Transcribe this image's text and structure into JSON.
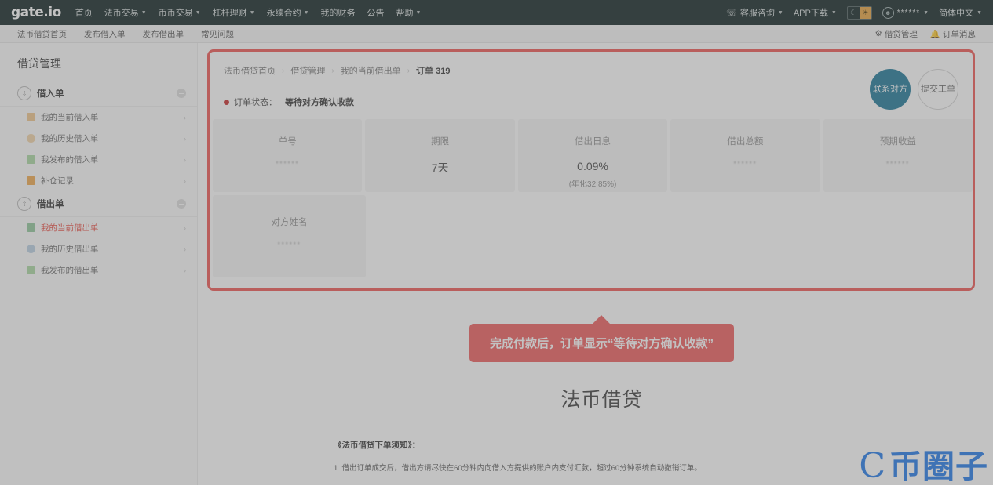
{
  "topnav": {
    "logo": "gate.io",
    "items": [
      {
        "label": "首页",
        "caret": false
      },
      {
        "label": "法币交易",
        "caret": true
      },
      {
        "label": "币币交易",
        "caret": true
      },
      {
        "label": "杠杆理财",
        "caret": true
      },
      {
        "label": "永续合约",
        "caret": true
      },
      {
        "label": "我的财务",
        "caret": false
      },
      {
        "label": "公告",
        "caret": false
      },
      {
        "label": "帮助",
        "caret": true
      }
    ],
    "right": {
      "support": "客服咨询",
      "app": "APP下载",
      "theme_moon": "☾",
      "theme_sun": "☀",
      "user": "******",
      "language": "简体中文"
    }
  },
  "subnav": {
    "items": [
      "法币借贷首页",
      "发布借入单",
      "发布借出单",
      "常见问题"
    ],
    "right": [
      {
        "icon": "gear-icon",
        "label": "借贷管理"
      },
      {
        "icon": "bell-icon",
        "label": "订单消息"
      }
    ]
  },
  "sidebar": {
    "title": "借贷管理",
    "groups": [
      {
        "name": "借入单",
        "icon": "borrow-icon",
        "items": [
          {
            "label": "我的当前借入单",
            "active": false,
            "color": "#e6a23c"
          },
          {
            "label": "我的历史借入单",
            "active": false,
            "color": "#e6a23c"
          },
          {
            "label": "我发布的借入单",
            "active": false,
            "color": "#67c23a"
          },
          {
            "label": "补仓记录",
            "active": false,
            "color": "#e6a23c"
          }
        ]
      },
      {
        "name": "借出单",
        "icon": "lend-icon",
        "items": [
          {
            "label": "我的当前借出单",
            "active": true,
            "color": "#5aa469"
          },
          {
            "label": "我的历史借出单",
            "active": false,
            "color": "#9fb8cf"
          },
          {
            "label": "我发布的借出单",
            "active": false,
            "color": "#67c23a"
          }
        ]
      }
    ]
  },
  "breadcrumb": {
    "items": [
      "法币借贷首页",
      "借贷管理",
      "我的当前借出单"
    ],
    "current": "订单 319",
    "separator": "›"
  },
  "order": {
    "status_label": "订单状态：",
    "status_value": "等待对方确认收款",
    "status_dot_color": "#c62828",
    "actions": [
      {
        "label": "联系对方",
        "style": "filled",
        "color": "#1b7697"
      },
      {
        "label": "提交工单",
        "style": "outline"
      }
    ],
    "cards": [
      {
        "label": "单号",
        "value": "******",
        "masked": true,
        "sub": ""
      },
      {
        "label": "期限",
        "value": "7天",
        "masked": false,
        "sub": ""
      },
      {
        "label": "借出日息",
        "value": "0.09%",
        "masked": false,
        "sub": "(年化32.85%)"
      },
      {
        "label": "借出总额",
        "value": "******",
        "masked": true,
        "sub": ""
      },
      {
        "label": "预期收益",
        "value": "******",
        "masked": true,
        "sub": ""
      }
    ],
    "cards_row2": [
      {
        "label": "对方姓名",
        "value": "******",
        "masked": true,
        "sub": ""
      }
    ]
  },
  "callout": {
    "text": "完成付款后，订单显示“等待对方确认收款”",
    "color": "#ee5a5a"
  },
  "lower": {
    "big_title": "法币借贷",
    "rules_title": "《法币借贷下单须知》：",
    "rules_line1": "1. 借出订单成交后，借出方请尽快在60分钟内向借入方提供的账户内支付汇款，超过60分钟系统自动撤销订单。"
  },
  "watermark": {
    "mark": "C",
    "text": "币圈子",
    "color": "#3f73b5"
  }
}
